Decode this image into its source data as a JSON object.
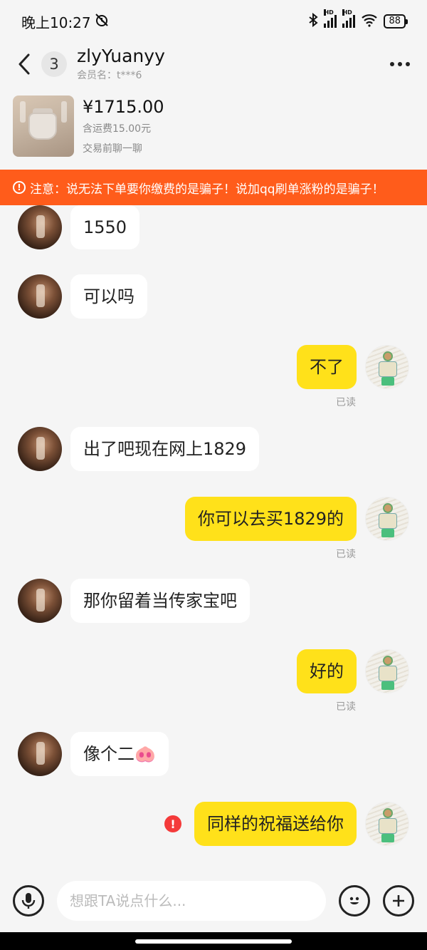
{
  "status_bar": {
    "time": "晚上10:27",
    "alarm_icon": "alarm-off-icon",
    "battery": "88",
    "hd1": "HD",
    "hd2": "HD"
  },
  "header": {
    "back_icon": "chevron-left-icon",
    "unread_count": "3",
    "name": "zlyYuanyy",
    "member_label": "会员名：t***6",
    "more_icon": "more-dots-icon"
  },
  "product": {
    "price": "¥1715.00",
    "shipping": "含运费15.00元",
    "chat_hint": "交易前聊一聊"
  },
  "warning": {
    "text": "注意：说无法下单要你缴费的是骗子！说加qq刷单涨粉的是骗子！",
    "icon": "!"
  },
  "messages": [
    {
      "side": "left",
      "text": "1550"
    },
    {
      "side": "left",
      "text": "可以吗"
    },
    {
      "side": "right",
      "text": "不了",
      "status": "已读"
    },
    {
      "side": "left",
      "text": "出了吧现在网上1829"
    },
    {
      "side": "right",
      "text": "你可以去买1829的",
      "status": "已读"
    },
    {
      "side": "left",
      "text": "那你留着当传家宝吧"
    },
    {
      "side": "right",
      "text": "好的",
      "status": "已读"
    },
    {
      "side": "left",
      "text": "像个二🐽"
    },
    {
      "side": "right",
      "text": "同样的祝福送给你",
      "failed_icon": "!"
    }
  ],
  "input": {
    "placeholder": "想跟TA说点什么...",
    "voice_icon": "microphone-icon",
    "emoji_icon": "smiley-icon",
    "plus_icon": "plus-icon"
  },
  "colors": {
    "warning_bg": "#ff5c1b",
    "own_bubble": "#ffe11a",
    "other_bubble": "#ffffff",
    "fail_red": "#f43a3a"
  }
}
